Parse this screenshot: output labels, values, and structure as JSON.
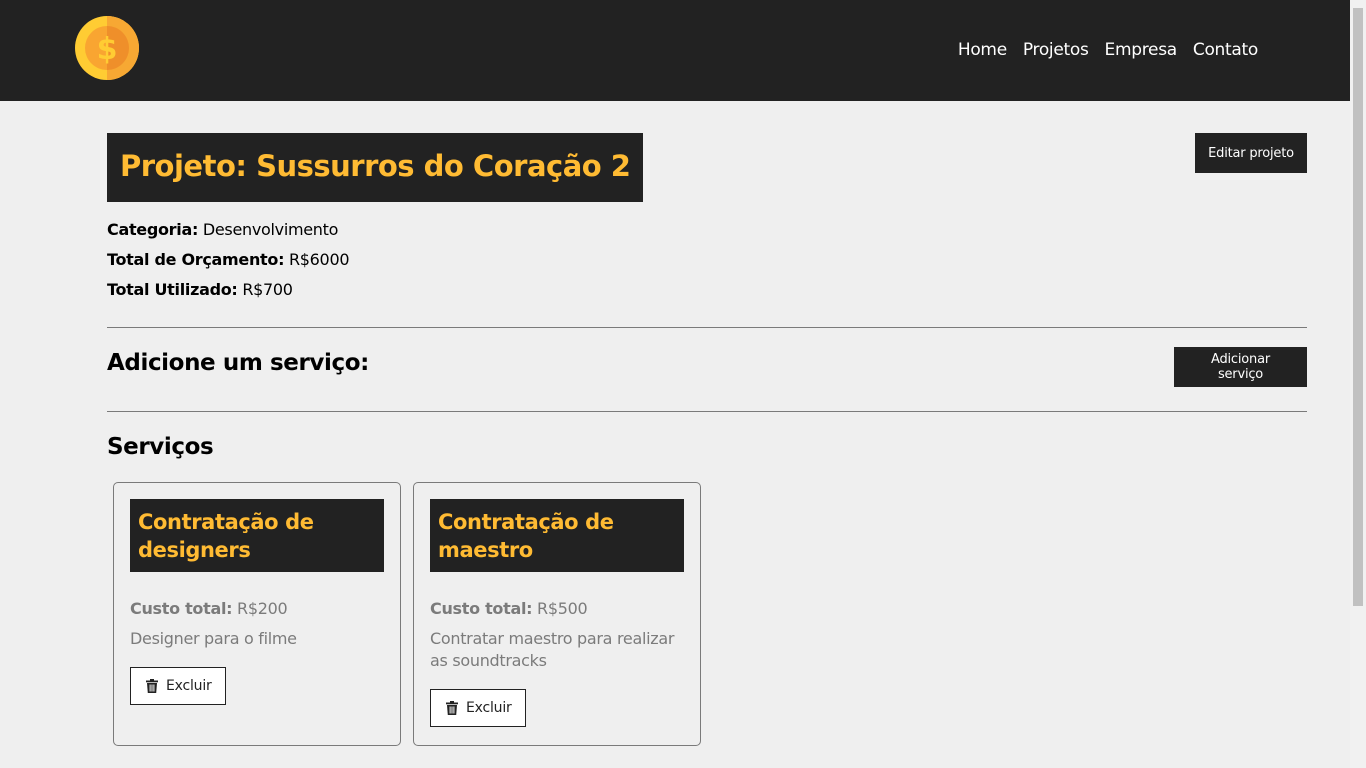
{
  "nav": {
    "logo_icon": "dollar-coin-icon",
    "items": [
      "Home",
      "Projetos",
      "Empresa",
      "Contato"
    ]
  },
  "project": {
    "title": "Projeto: Sussurros do Coração 2",
    "edit_label": "Editar projeto",
    "category_label": "Categoria:",
    "category_value": "Desenvolvimento",
    "budget_label": "Total de Orçamento:",
    "budget_value": "R$6000",
    "used_label": "Total Utilizado:",
    "used_value": "R$700"
  },
  "add_service": {
    "title": "Adicione um serviço:",
    "button_label": "Adicionar serviço"
  },
  "services": {
    "title": "Serviços",
    "cost_label": "Custo total:",
    "delete_label": "Excluir",
    "delete_icon": "trash-icon",
    "items": [
      {
        "title": "Contratação de designers",
        "cost": "R$200",
        "description": "Designer para o filme"
      },
      {
        "title": "Contratação de maestro",
        "cost": "R$500",
        "description": "Contratar maestro para realizar as soundtracks"
      }
    ]
  },
  "colors": {
    "dark": "#222222",
    "accent": "#ffbb33",
    "background": "#efefef",
    "muted_text": "#7b7b7b"
  }
}
